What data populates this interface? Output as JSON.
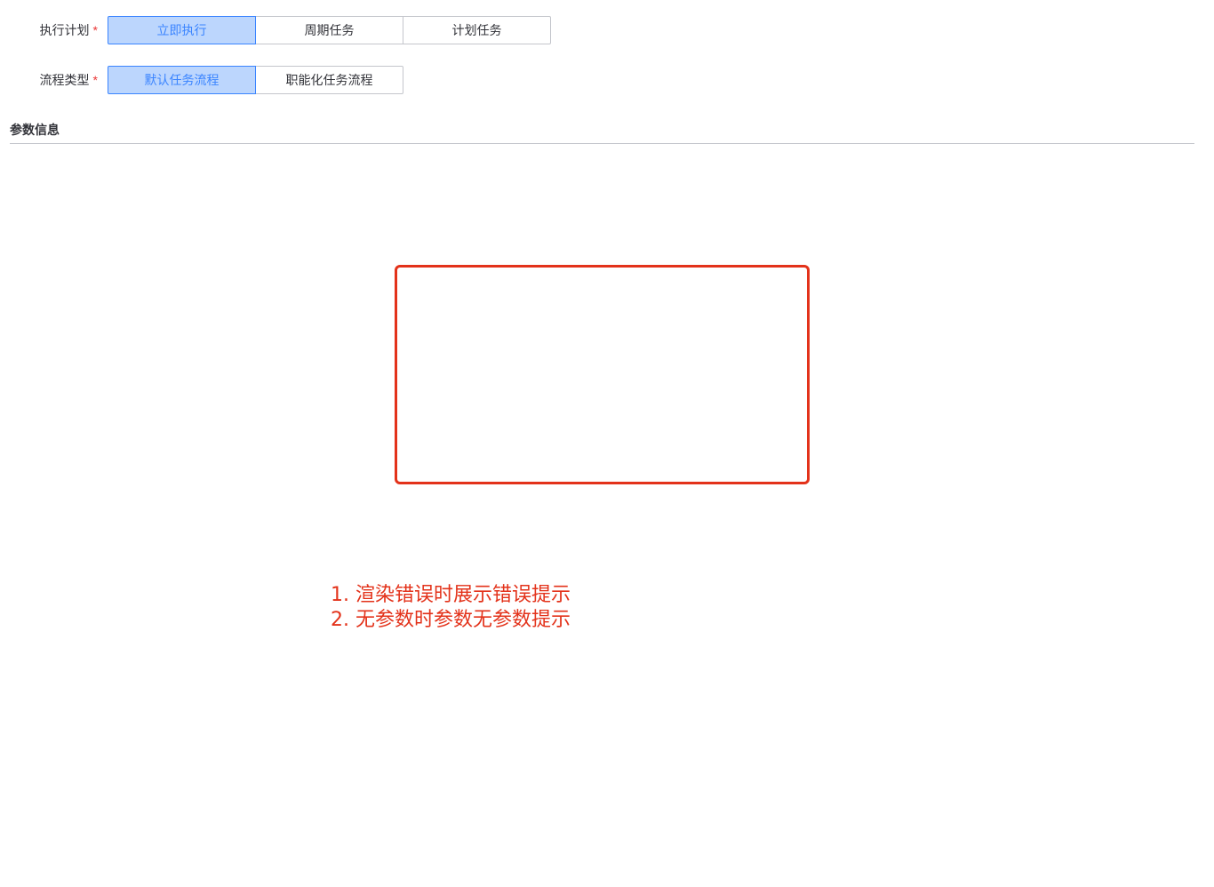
{
  "form": {
    "plan": {
      "label": "执行计划",
      "required_mark": "*",
      "options": [
        "立即执行",
        "周期任务",
        "计划任务"
      ],
      "selected": "立即执行"
    },
    "flow": {
      "label": "流程类型",
      "required_mark": "*",
      "options": [
        "默认任务流程",
        "职能化任务流程"
      ],
      "selected": "默认任务流程"
    }
  },
  "params": {
    "title": "参数信息"
  },
  "annotation": {
    "notes": [
      "1. 渲染错误时展示错误提示",
      "2. 无参数时参数无参数提示"
    ]
  },
  "colors": {
    "accent": "#3a84ff",
    "selected_bg": "#bcd6fd",
    "required": "#ea3636",
    "annotation": "#e3321a",
    "border": "#c4c6cc"
  }
}
